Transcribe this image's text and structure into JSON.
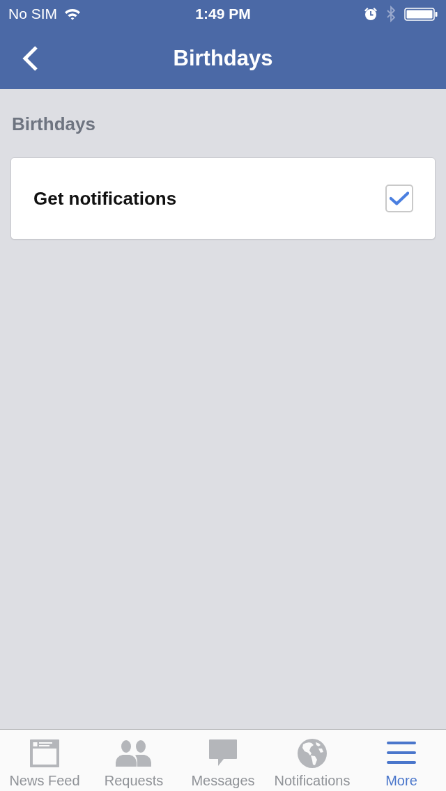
{
  "status_bar": {
    "carrier": "No SIM",
    "time": "1:49 PM"
  },
  "nav_bar": {
    "title": "Birthdays"
  },
  "section": {
    "heading": "Birthdays",
    "rows": [
      {
        "label": "Get notifications",
        "checked": true
      }
    ]
  },
  "tab_bar": {
    "tabs": [
      {
        "kind": "feed",
        "label": "News Feed",
        "selected": false
      },
      {
        "kind": "people",
        "label": "Requests",
        "selected": false
      },
      {
        "kind": "message",
        "label": "Messages",
        "selected": false
      },
      {
        "kind": "globe",
        "label": "Notifications",
        "selected": false
      },
      {
        "kind": "menu",
        "label": "More",
        "selected": true
      }
    ]
  }
}
